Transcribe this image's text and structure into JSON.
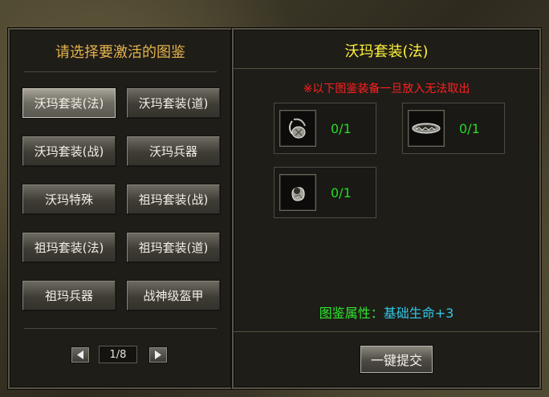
{
  "left": {
    "title": "请选择要激活的图鉴",
    "buttons": [
      "沃玛套装(法)",
      "沃玛套装(道)",
      "沃玛套装(战)",
      "沃玛兵器",
      "沃玛特殊",
      "祖玛套装(战)",
      "祖玛套装(法)",
      "祖玛套装(道)",
      "祖玛兵器",
      "战神级盔甲"
    ],
    "selected_index": 0,
    "pager": {
      "text": "1/8"
    }
  },
  "right": {
    "title": "沃玛套装(法)",
    "warning": "※以下图鉴装备一旦放入无法取出",
    "items": [
      {
        "icon": "necklace-icon",
        "count": "0/1"
      },
      {
        "icon": "bracelet-icon",
        "count": "0/1"
      },
      {
        "icon": "ring-icon",
        "count": "0/1"
      }
    ],
    "attribute_label": "图鉴属性：",
    "attribute_value": "基础生命+3",
    "submit_label": "一键提交"
  },
  "colors": {
    "left_title": "#e3b24c",
    "right_title": "#fff23a",
    "warning": "#ff2020",
    "count": "#22dd22",
    "attr_label": "#2ee82e",
    "attr_value": "#2ec9e8"
  }
}
